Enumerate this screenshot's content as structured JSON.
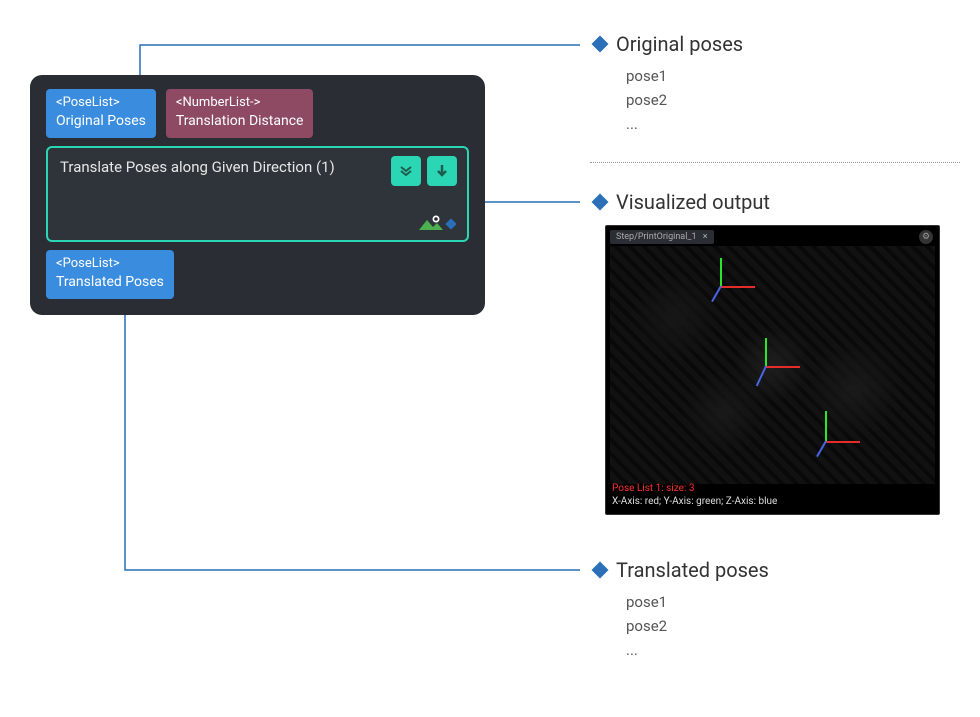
{
  "node": {
    "input_ports": [
      {
        "type": "<PoseList>",
        "name": "Original Poses",
        "css": "port-blue"
      },
      {
        "type": "<NumberList->",
        "name": "Translation Distance",
        "css": "port-maroon"
      }
    ],
    "title": "Translate Poses along Given Direction (1)",
    "output_ports": [
      {
        "type": "<PoseList>",
        "name": "Translated Poses",
        "css": "port-blue"
      }
    ]
  },
  "annotations": {
    "original": {
      "heading": "Original poses",
      "items": [
        "pose1",
        "pose2",
        "..."
      ]
    },
    "visualized": {
      "heading": "Visualized output"
    },
    "translated": {
      "heading": "Translated poses",
      "items": [
        "pose1",
        "pose2",
        "..."
      ]
    }
  },
  "viewer": {
    "tab": "Step/PrintOriginal_1",
    "tab_close": "×",
    "footer_line1": "Pose List 1: size: 3",
    "footer_line2": "X-Axis: red; Y-Axis: green; Z-Axis: blue"
  },
  "icons": {
    "expand": "expand-down-icon",
    "collapse": "arrow-down-icon",
    "visualize": "eye-icon"
  }
}
